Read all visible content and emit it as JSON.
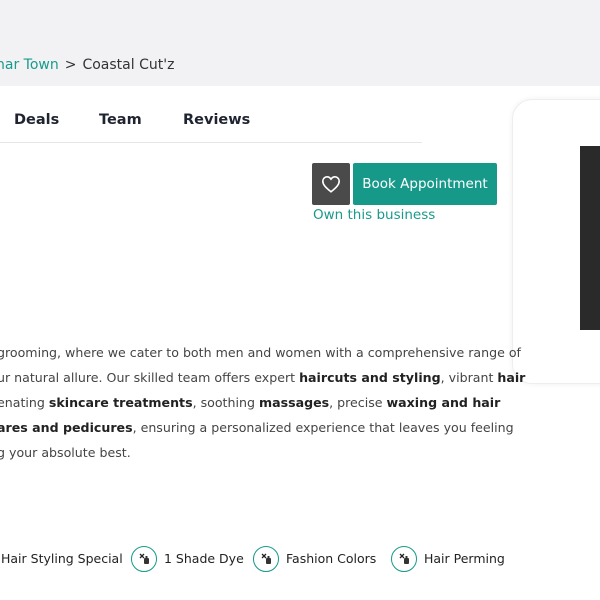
{
  "breadcrumb": {
    "parent": "har Town",
    "separator": ">",
    "current": "Coastal Cut'z"
  },
  "tabs": [
    {
      "label": "Deals"
    },
    {
      "label": "Team"
    },
    {
      "label": "Reviews"
    }
  ],
  "actions": {
    "favorite_icon": "heart-icon",
    "book_label": "Book Appointment",
    "own_business_label": "Own this business"
  },
  "description": {
    "line1": "grooming, where we cater to both men and women with a comprehensive range of",
    "line2_a": "ur natural allure. Our skilled team offers expert ",
    "line2_b": "haircuts and styling",
    "line2_c": ", vibrant ",
    "line2_d": "hair",
    "line3_a": "enating ",
    "line3_b": "skincare treatments",
    "line3_c": ", soothing ",
    "line3_d": "massages",
    "line3_e": ", precise ",
    "line3_f": "waxing and hair",
    "line4_a": "ares and pedicures",
    "line4_b": ", ensuring a personalized experience that leaves you feeling",
    "line5": "g your absolute best."
  },
  "services": [
    {
      "label": "Hair Styling Special"
    },
    {
      "label": "1 Shade Dye",
      "icon": "hair-dye-icon"
    },
    {
      "label": "Fashion Colors",
      "icon": "hair-dye-icon"
    },
    {
      "label": "Hair Perming",
      "icon": "hair-dye-icon"
    }
  ],
  "colors": {
    "accent": "#17998a",
    "heart_button": "#4a4a4a",
    "top_band": "#f2f2f5"
  }
}
